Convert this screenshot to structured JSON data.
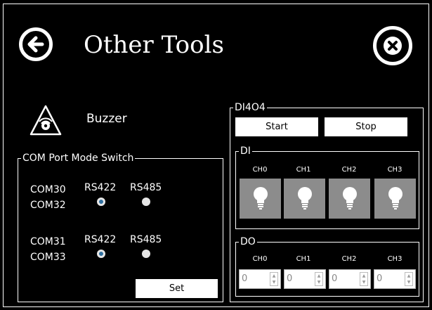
{
  "header": {
    "title": "Other Tools",
    "back_icon": "arrow-left-icon",
    "close_icon": "close-icon"
  },
  "buzzer": {
    "label": "Buzzer",
    "icon": "buzzer-icon"
  },
  "com_group": {
    "title": "COM Port Mode Switch",
    "rows": [
      {
        "ports": [
          "COM30",
          "COM32"
        ],
        "options": [
          "RS422",
          "RS485"
        ],
        "selected": "RS422"
      },
      {
        "ports": [
          "COM31",
          "COM33"
        ],
        "options": [
          "RS422",
          "RS485"
        ],
        "selected": "RS422"
      }
    ],
    "set_label": "Set"
  },
  "dio": {
    "title": "DI4O4",
    "start_label": "Start",
    "stop_label": "Stop",
    "di": {
      "title": "DI",
      "channels": [
        "CH0",
        "CH1",
        "CH2",
        "CH3"
      ],
      "indicator_icon": "lightbulb-icon"
    },
    "do": {
      "title": "DO",
      "channels": [
        "CH0",
        "CH1",
        "CH2",
        "CH3"
      ],
      "values": [
        "0",
        "0",
        "0",
        "0"
      ]
    }
  }
}
